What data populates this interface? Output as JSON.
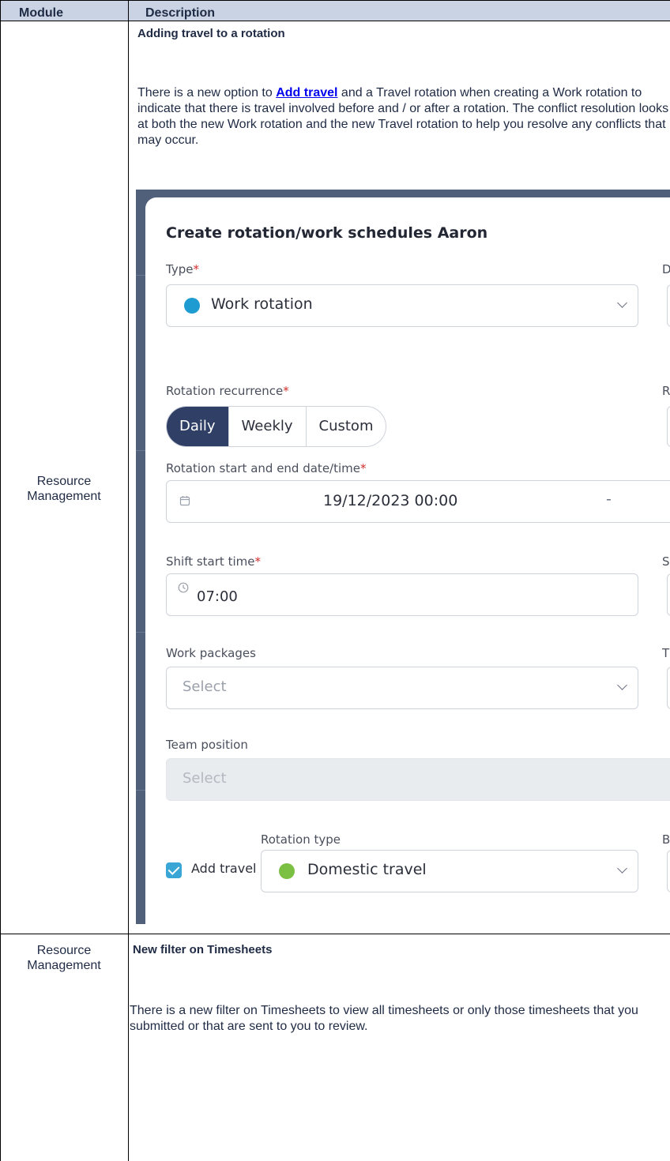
{
  "table": {
    "headers": {
      "module": "Module",
      "description": "Description"
    }
  },
  "rows": [
    {
      "module": "Resource Management",
      "title": "Adding travel to a rotation",
      "para_before_link": "There is a new option to ",
      "link_text": "Add travel",
      "para_after_link": " and a Travel rotation when creating a Work rotation to indicate that there is travel involved before and / or after a rotation. The conflict resolution looks at both the new Work rotation and the new Travel rotation to help you resolve any conflicts that may occur."
    },
    {
      "module": "Resource Management",
      "title": "New filter on Timesheets",
      "paragraph": "There is a new filter on Timesheets to view all timesheets or only those timesheets that you submitted or that are sent to you to review."
    }
  ],
  "dialog": {
    "title": "Create rotation/work schedules Aaron",
    "type_label": "Type",
    "type_value": "Work rotation",
    "recurrence_label": "Rotation recurrence",
    "recurrence_options": [
      "Daily",
      "Weekly",
      "Custom"
    ],
    "date_label": "Rotation start and end date/time",
    "date_value": "19/12/2023  00:00",
    "date_separator": "-",
    "shift_label": "Shift start time",
    "shift_value": "07:00",
    "work_packages_label": "Work packages",
    "work_packages_placeholder": "Select",
    "team_position_label": "Team position",
    "team_position_placeholder": "Select",
    "rotation_type_label": "Rotation type",
    "add_travel_label": "Add travel",
    "rotation_type_value": "Domestic travel",
    "right_edge_letters": [
      "D",
      "R",
      "S",
      "T",
      "B"
    ],
    "colors": {
      "work_dot": "#1e9bd0",
      "travel_dot": "#7bc043",
      "required": "#d0302d",
      "segment_active": "#2f3f66"
    }
  }
}
